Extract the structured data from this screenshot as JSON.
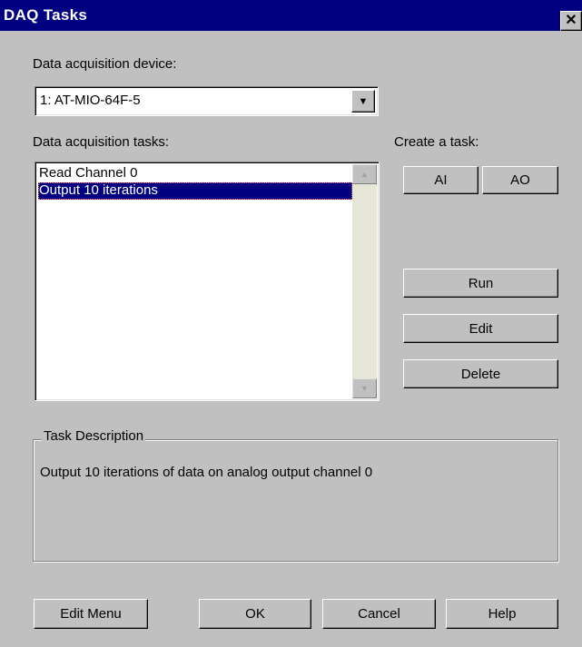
{
  "window": {
    "title": "DAQ Tasks",
    "close_glyph": "✕"
  },
  "device": {
    "label": "Data acquisition device:",
    "value": "1: AT-MIO-64F-5",
    "arrow_icon": "▼"
  },
  "tasks": {
    "label": "Data acquisition tasks:",
    "items": [
      "Read Channel 0",
      "Output 10 iterations"
    ],
    "selected_index": 1,
    "scroll_up_icon": "▲",
    "scroll_down_icon": "▼"
  },
  "create": {
    "label": "Create a task:",
    "ai_label": "AI",
    "ao_label": "AO"
  },
  "actions": {
    "run_label": "Run",
    "edit_label": "Edit",
    "delete_label": "Delete"
  },
  "description": {
    "legend": "Task Description",
    "text": "Output 10 iterations of data on analog output channel 0"
  },
  "footer": {
    "edit_menu_label": "Edit Menu",
    "ok_label": "OK",
    "cancel_label": "Cancel",
    "help_label": "Help"
  },
  "colors": {
    "titlebar": "#000080",
    "face": "#c0c0c0",
    "selection": "#000080"
  }
}
